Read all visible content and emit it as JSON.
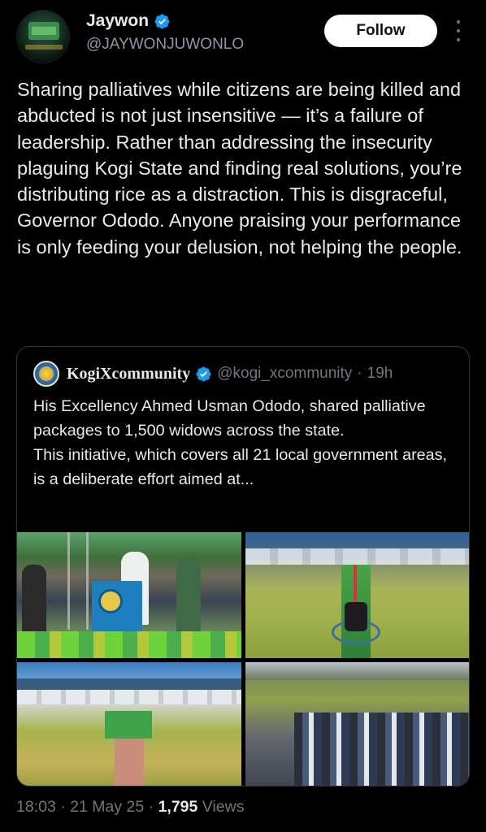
{
  "author": {
    "name": "Jaywon",
    "handle": "@JAYWONJUWONLO",
    "verified_color": "#1d9bf0"
  },
  "follow_label": "Follow",
  "tweet_text": "Sharing palliatives while citizens are being killed and abducted is not just insensitive — it’s a failure of leadership. Rather than addressing the insecurity plaguing Kogi State and finding real solutions, you’re distributing rice as a distraction. This is disgraceful, Governor Ododo. Anyone praising your performance is only feeding your delusion, not helping the people.",
  "quoted": {
    "name": "KogiXcommunity",
    "handle": "@kogi_xcommunity",
    "separator": "·",
    "time": "19h",
    "text_line1": "His Excellency Ahmed Usman Ododo, shared palliative packages to 1,500 widows across the state.",
    "text_line2": "This initiative, which covers all 21 local government areas, is a deliberate effort aimed at..."
  },
  "meta": {
    "time": "18:03",
    "separator": "·",
    "date": "21 May 25",
    "views_count": "1,795",
    "views_label": "Views"
  },
  "icons": {
    "verified": "verified-badge-icon",
    "more": "more-vertical-icon"
  },
  "colors": {
    "background": "#000000",
    "text": "#e7e9ea",
    "secondary": "#71767b",
    "accent": "#1d9bf0"
  }
}
